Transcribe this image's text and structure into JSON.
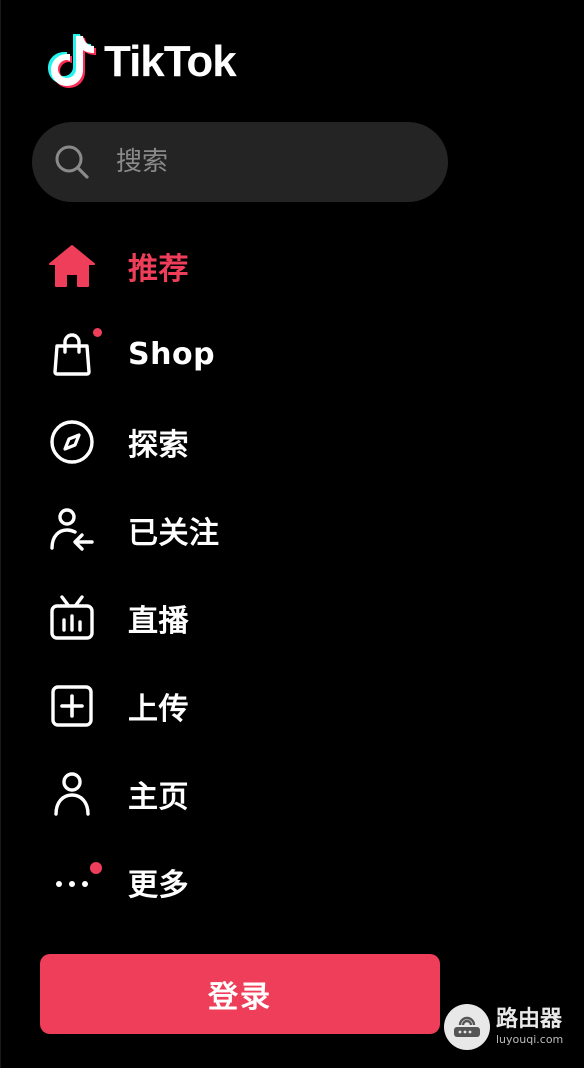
{
  "logo": {
    "text": "TikTok"
  },
  "search": {
    "placeholder": "搜索",
    "value": ""
  },
  "nav": {
    "items": [
      {
        "label": "推荐",
        "icon": "home-icon",
        "active": true
      },
      {
        "label": "Shop",
        "icon": "shopping-bag-icon",
        "badge_dot": true
      },
      {
        "label": "探索",
        "icon": "compass-icon"
      },
      {
        "label": "已关注",
        "icon": "following-user-icon"
      },
      {
        "label": "直播",
        "icon": "live-tv-icon"
      },
      {
        "label": "上传",
        "icon": "upload-plus-icon"
      },
      {
        "label": "主页",
        "icon": "profile-icon"
      },
      {
        "label": "更多",
        "icon": "more-dots-icon",
        "badge_dot": true
      }
    ]
  },
  "login": {
    "label": "登录"
  },
  "watermark": {
    "title": "路由器",
    "subtitle": "luyouqi.com"
  },
  "colors": {
    "background": "#000000",
    "accent": "#ee3e5a",
    "search_bg": "#242424",
    "placeholder": "#8a8a8a",
    "text": "#ffffff"
  }
}
